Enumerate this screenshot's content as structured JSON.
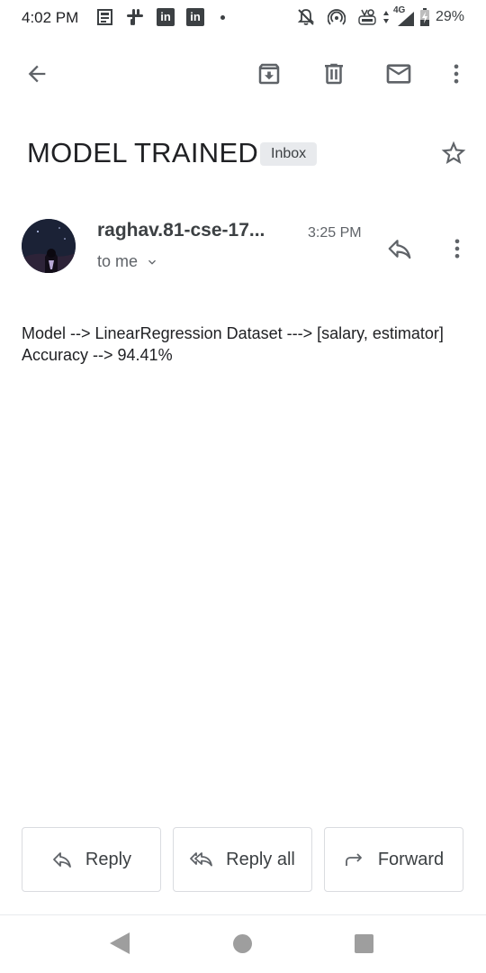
{
  "status_bar": {
    "time": "4:02 PM",
    "network_label": "4G",
    "battery": "29%",
    "icons": [
      "news-icon",
      "slack-icon",
      "linkedin-icon",
      "linkedin-icon",
      "notification-dot",
      "notifications-off-icon",
      "hotspot-icon",
      "volte-icon",
      "signal-icon",
      "battery-icon"
    ],
    "linkedin_glyph": "in"
  },
  "action_bar": {
    "icons": [
      "back-arrow-icon",
      "archive-icon",
      "delete-icon",
      "mark-unread-icon",
      "more-vert-icon"
    ]
  },
  "email": {
    "subject": "MODEL TRAINED",
    "label": "Inbox",
    "sender": "raghav.81-cse-17...",
    "time": "3:25 PM",
    "recipient": "to me",
    "body": "Model --> LinearRegression Dataset ---> [salary, estimator]   Accuracy --> 94.41%"
  },
  "actions": {
    "reply": "Reply",
    "reply_all": "Reply all",
    "forward": "Forward"
  },
  "colors": {
    "text_primary": "#202124",
    "text_secondary": "#5f6368",
    "icon": "#5f6368",
    "chip_bg": "#e8eaed",
    "border": "#dadce0"
  }
}
